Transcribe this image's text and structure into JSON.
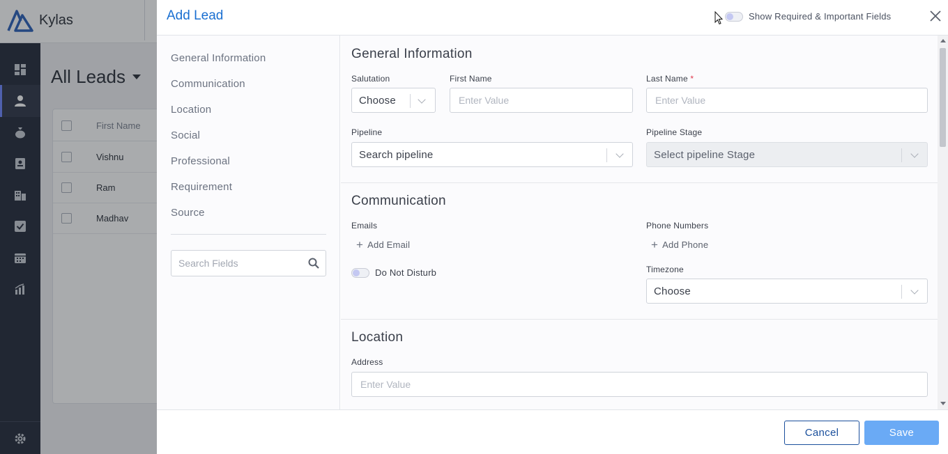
{
  "app": {
    "brand": "Kylas",
    "page_title": "All Leads",
    "table": {
      "header": "First Name",
      "rows": [
        "Vishnu",
        "Ram",
        "Madhav"
      ]
    },
    "rail_icons": [
      "dashboard-icon",
      "user-icon",
      "money-bag-icon",
      "contact-card-icon",
      "building-icon",
      "task-check-icon",
      "calendar-icon",
      "reports-icon",
      "settings-icon"
    ]
  },
  "modal": {
    "title": "Add Lead",
    "toggle_label": "Show Required & Important Fields",
    "nav": [
      "General Information",
      "Communication",
      "Location",
      "Social",
      "Professional",
      "Requirement",
      "Source"
    ],
    "search_placeholder": "Search Fields",
    "sections": {
      "general": {
        "title": "General Information",
        "salutation_label": "Salutation",
        "salutation_value": "Choose",
        "first_name_label": "First Name",
        "first_name_placeholder": "Enter Value",
        "last_name_label": "Last Name",
        "required_mark": "*",
        "last_name_placeholder": "Enter Value",
        "pipeline_label": "Pipeline",
        "pipeline_value": "Search pipeline",
        "pipeline_stage_label": "Pipeline Stage",
        "pipeline_stage_value": "Select pipeline Stage"
      },
      "communication": {
        "title": "Communication",
        "emails_label": "Emails",
        "add_email": "Add Email",
        "phones_label": "Phone Numbers",
        "add_phone": "Add Phone",
        "dnd_label": "Do Not Disturb",
        "timezone_label": "Timezone",
        "timezone_value": "Choose"
      },
      "location": {
        "title": "Location",
        "address_label": "Address",
        "address_placeholder": "Enter Value"
      }
    },
    "footer": {
      "cancel": "Cancel",
      "save": "Save"
    }
  },
  "colors": {
    "accent": "#1a6fd1",
    "save_button": "#6aaaf5",
    "cancel_border": "#1a4f9c",
    "rail": "#252b3a",
    "required": "#e0384b"
  }
}
